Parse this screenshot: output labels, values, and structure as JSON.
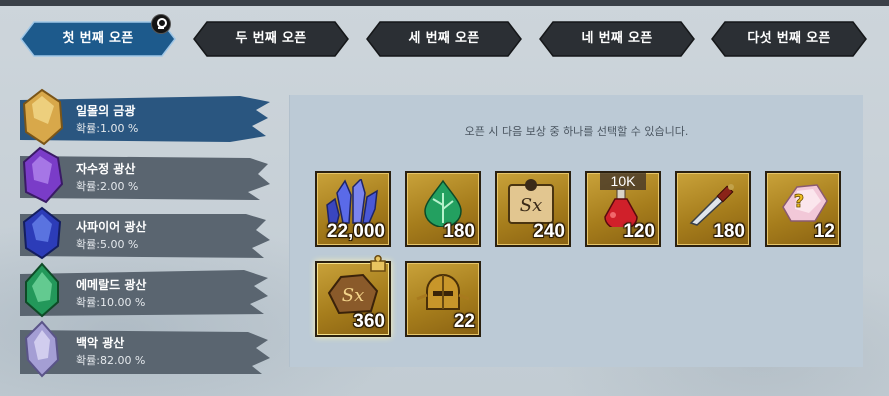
{
  "tabs": [
    {
      "label": "첫 번째 오픈",
      "active": true
    },
    {
      "label": "두 번째 오픈",
      "active": false
    },
    {
      "label": "세 번째 오픈",
      "active": false
    },
    {
      "label": "네 번째 오픈",
      "active": false
    },
    {
      "label": "다섯 번째 오픈",
      "active": false
    }
  ],
  "ores": [
    {
      "name": "일몰의 금광",
      "rate": "확률:1.00 %",
      "icon": "gold-ore-icon",
      "color": "#d8a84a"
    },
    {
      "name": "자수정 광산",
      "rate": "확률:2.00 %",
      "icon": "amethyst-ore-icon",
      "color": "#8a4ad8"
    },
    {
      "name": "사파이어 광산",
      "rate": "확률:5.00 %",
      "icon": "sapphire-ore-icon",
      "color": "#3a4ed0"
    },
    {
      "name": "에메랄드 광산",
      "rate": "확률:10.00 %",
      "icon": "emerald-ore-icon",
      "color": "#2ea85a"
    },
    {
      "name": "백악 광산",
      "rate": "확률:82.00 %",
      "icon": "chalk-ore-icon",
      "color": "#a8a2d6"
    }
  ],
  "rewards": {
    "hint": "오픈 시 다음 보상 중 하나를 선택할 수 있습니다.",
    "items": [
      {
        "icon": "blue-crystal-icon",
        "count": "22,000"
      },
      {
        "icon": "green-drop-icon",
        "count": "180"
      },
      {
        "icon": "sx-puzzle-icon",
        "count": "240"
      },
      {
        "icon": "red-potion-icon",
        "count": "120",
        "tag": "10K"
      },
      {
        "icon": "dagger-icon",
        "count": "180"
      },
      {
        "icon": "mystery-crystal-icon",
        "count": "12"
      },
      {
        "icon": "sx-stone-icon",
        "count": "360"
      },
      {
        "icon": "golden-helmet-icon",
        "count": "22"
      }
    ]
  },
  "colors": {
    "active_tab": "#1d5a8c",
    "inactive_tab": "#2b2f34",
    "panel": "#bccad6",
    "item_gold": "#b08a2a"
  }
}
